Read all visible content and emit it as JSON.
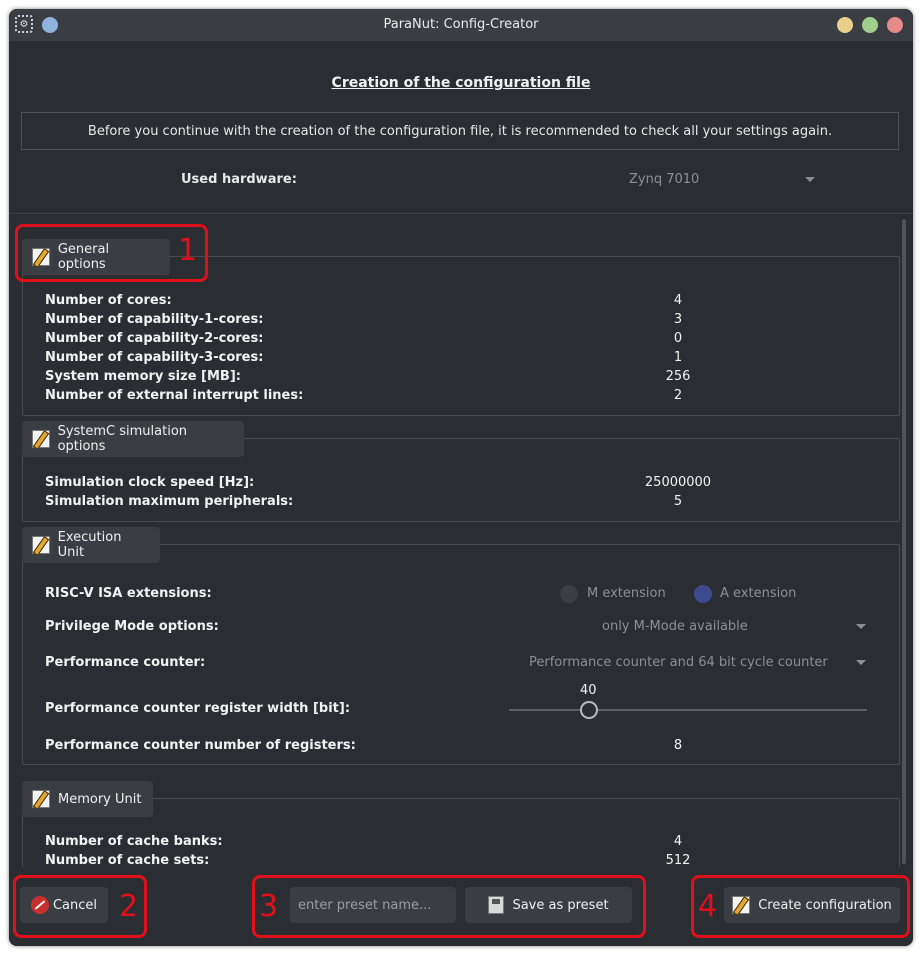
{
  "window": {
    "title": "ParaNut: Config-Creator"
  },
  "header": {
    "page_title": "Creation of the configuration file",
    "notice": "Before you continue with the creation of the configuration file, it is recommended to check all your settings again.",
    "hardware_label": "Used hardware:",
    "hardware_value": "Zynq 7010"
  },
  "general": {
    "title": "General options",
    "rows": [
      {
        "label": "Number of cores:",
        "value": "4"
      },
      {
        "label": "Number of capability-1-cores:",
        "value": "3"
      },
      {
        "label": "Number of capability-2-cores:",
        "value": "0"
      },
      {
        "label": "Number of capability-3-cores:",
        "value": "1"
      },
      {
        "label": "System memory size [MB]:",
        "value": "256"
      },
      {
        "label": "Number of external interrupt lines:",
        "value": "2"
      }
    ]
  },
  "systemc": {
    "title": "SystemC simulation options",
    "rows": [
      {
        "label": "Simulation clock speed [Hz]:",
        "value": "25000000"
      },
      {
        "label": "Simulation maximum peripherals:",
        "value": "5"
      }
    ]
  },
  "exu": {
    "title": "Execution Unit",
    "isa_label": "RISC-V ISA extensions:",
    "m_ext": "M extension",
    "a_ext": "A extension",
    "m_checked": false,
    "a_checked": true,
    "priv_label": "Privilege Mode options:",
    "priv_value": "only M-Mode available",
    "perf_label": "Performance counter:",
    "perf_value": "Performance counter and 64 bit cycle counter",
    "width_label": "Performance counter register width [bit]:",
    "width_value": "40",
    "regs_label": "Performance counter number of registers:",
    "regs_value": "8"
  },
  "memu": {
    "title": "Memory Unit",
    "rows": [
      {
        "label": "Number of cache banks:",
        "value": "4"
      },
      {
        "label": "Number of cache sets:",
        "value": "512"
      }
    ]
  },
  "footer": {
    "cancel": "Cancel",
    "preset_placeholder": "enter preset name...",
    "save_preset": "Save as preset",
    "create": "Create configuration"
  },
  "annotations": [
    "1",
    "2",
    "3",
    "4"
  ],
  "colors": {
    "annotation": "#e0101a",
    "radio_on": "#3d4a8f",
    "background": "#2a2d31"
  }
}
